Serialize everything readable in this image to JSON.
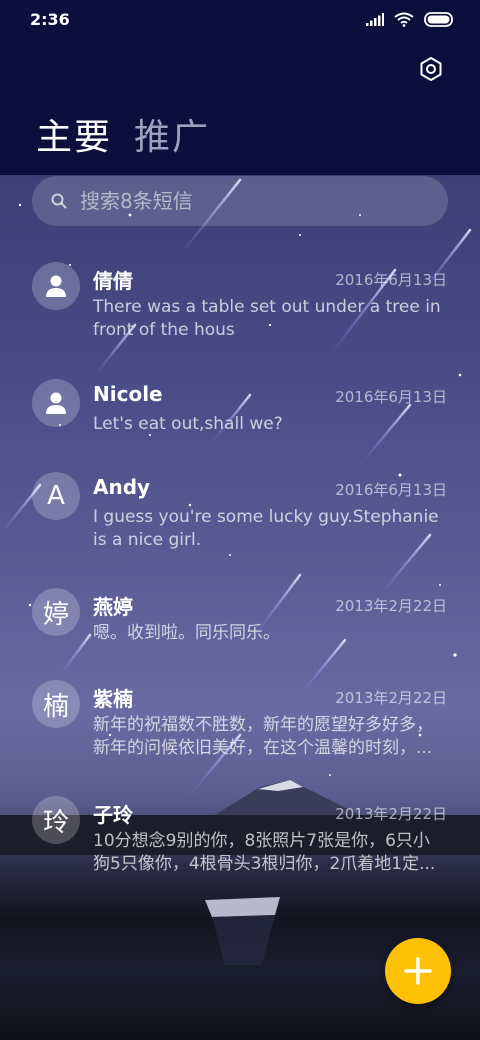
{
  "status_bar": {
    "time": "2:36"
  },
  "tabs": [
    {
      "label": "主要"
    },
    {
      "label": "推广"
    }
  ],
  "search": {
    "placeholder": "搜索8条短信"
  },
  "messages": [
    {
      "avatar": "",
      "avatar_icon": "person-icon",
      "name": "倩倩",
      "date": "2016年6月13日",
      "snippet": "There was a table set out under a tree in front of the hous"
    },
    {
      "avatar": "",
      "avatar_icon": "person-icon",
      "name": "Nicole",
      "date": "2016年6月13日",
      "snippet": "Let's eat out,shall we?"
    },
    {
      "avatar": "A",
      "name": "Andy",
      "date": "2016年6月13日",
      "snippet": "I guess you're some lucky guy.Stephanie is a nice girl."
    },
    {
      "avatar": "婷",
      "name": "燕婷",
      "date": "2013年2月22日",
      "snippet": "嗯。收到啦。同乐同乐。"
    },
    {
      "avatar": "楠",
      "name": "紫楠",
      "date": "2013年2月22日",
      "snippet": "新年的祝福数不胜数，新年的愿望好多好多，新年的问候依旧美好，在这个温馨的时刻，..."
    },
    {
      "avatar": "玲",
      "name": "子玲",
      "date": "2013年2月22日",
      "snippet": "10分想念9别的你，8张照片7张是你，6只小狗5只像你，4根骨头3根归你，2爪着地1定..."
    }
  ],
  "colors": {
    "fab": "#ffc107",
    "header": "#0c0f3c"
  }
}
